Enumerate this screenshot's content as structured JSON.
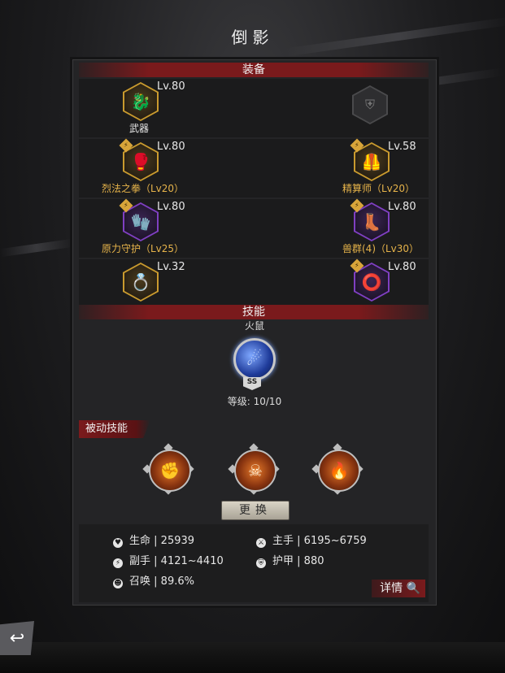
{
  "title": "倒影",
  "equipment": {
    "header": "装备",
    "slots": [
      {
        "level": "Lv.80",
        "name": "武器",
        "name_color": "white",
        "frame": "gold",
        "icon": "dragon-icon"
      },
      {
        "level": "",
        "name": "",
        "name_color": "",
        "frame": "gray",
        "icon": "shield-icon"
      },
      {
        "level": "Lv.80",
        "name": "烈法之拳（Lv20）",
        "name_color": "gold",
        "frame": "gold",
        "icon": "gauntlet-icon"
      },
      {
        "level": "Lv.58",
        "name": "精算师（Lv20）",
        "name_color": "gold",
        "frame": "gold",
        "icon": "chest-armor-icon"
      },
      {
        "level": "Lv.80",
        "name": "原力守护（Lv25）",
        "name_color": "gold",
        "frame": "purple",
        "icon": "glove-icon"
      },
      {
        "level": "Lv.80",
        "name": "兽群(4)（Lv30）",
        "name_color": "gold",
        "frame": "purple",
        "icon": "boots-icon"
      },
      {
        "level": "Lv.32",
        "name": "",
        "name_color": "",
        "frame": "gold",
        "icon": "ring-icon"
      },
      {
        "level": "Lv.80",
        "name": "",
        "name_color": "",
        "frame": "purple",
        "icon": "belt-icon"
      }
    ]
  },
  "skills": {
    "header": "技能",
    "active_name": "火鼠",
    "rank": "SS",
    "level_text": "等级: 10/10",
    "passive_label": "被动技能",
    "passives": [
      {
        "icon": "shield-fist-icon"
      },
      {
        "icon": "skull-flame-icon"
      },
      {
        "icon": "fire-burst-icon"
      }
    ],
    "change_button": "更换"
  },
  "stats": {
    "hp": {
      "label": "生命",
      "value": "25939",
      "icon": "heart-icon"
    },
    "main_hand": {
      "label": "主手",
      "value": "6195~6759",
      "icon": "sword-icon"
    },
    "off_hand": {
      "label": "副手",
      "value": "4121~4410",
      "icon": "slash-icon"
    },
    "armor": {
      "label": "护甲",
      "value": "880",
      "icon": "armor-icon"
    },
    "summon": {
      "label": "召唤",
      "value": "89.6%",
      "icon": "summon-icon"
    }
  },
  "detail_button": "详情",
  "colors": {
    "accent_red": "#7a1a1c",
    "gold": "#c99a2e",
    "purple": "#7f3fc2"
  }
}
